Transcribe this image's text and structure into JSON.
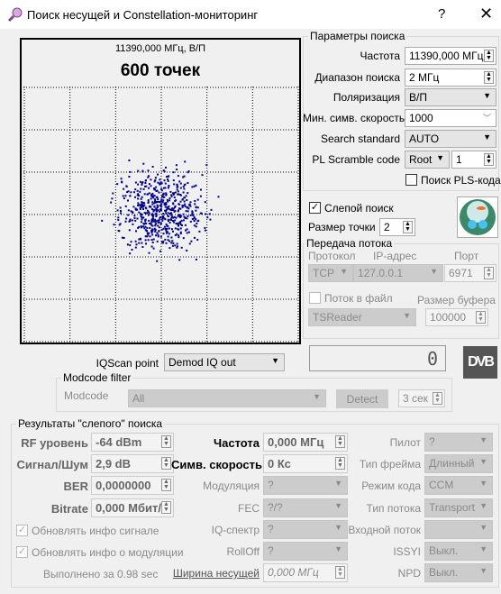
{
  "window": {
    "title": "Поиск несущей и Constellation-мониторинг",
    "help": "?",
    "close": "✕"
  },
  "plot": {
    "freq_label": "11390,000 МГц, В/П",
    "points_label": "600 точек",
    "point_color": "#00008b",
    "grid": "dotted 6x6"
  },
  "chart_data": {
    "type": "scatter",
    "point_count": 600,
    "center": [
      0,
      0
    ]
  },
  "search": {
    "title": "Параметры поиска",
    "freq_label": "Частота",
    "freq": "11390,000 МГц",
    "range_label": "Диапазон поиска",
    "range": "2 МГц",
    "pol_label": "Поляризация",
    "pol": "В/П",
    "minsr_label": "Мин. симв. скорость",
    "minsr": "1000",
    "std_label": "Search standard",
    "std": "AUTO",
    "pls_label": "PL Scramble code",
    "pls_mode": "Root",
    "pls_value": "1",
    "pls_search_label": "Поиск PLS-кода"
  },
  "blind": {
    "label": "Слепой поиск",
    "checked": true,
    "dot_size_label": "Размер точки",
    "dot_size": "2"
  },
  "stream": {
    "title": "Передача потока",
    "proto_label": "Протокол",
    "ip_label": "IP-адрес",
    "port_label": "Порт",
    "proto": "TCP",
    "ip": "127.0.0.1",
    "port": "6971",
    "tofile_label": "Поток в файл",
    "buffer_label": "Размер буфера",
    "reader": "TSReader",
    "buffer": "100000"
  },
  "counter": "0",
  "dvb_logo": "DVB",
  "iqscan": {
    "label": "IQScan point",
    "value": "Demod IQ out"
  },
  "modcode": {
    "title": "Modcode filter",
    "label": "Modcode",
    "value": "All",
    "detect": "Detect",
    "timeout": "3 сек"
  },
  "results": {
    "title": "Результаты \"слепого\" поиска",
    "rf_label": "RF уровень",
    "rf": "-64 dBm",
    "snr_label": "Сигнал/Шум",
    "snr": "2,9 dB",
    "ber_label": "BER",
    "ber": "0,0000000",
    "bitrate_label": "Bitrate",
    "bitrate": "0,000 Мбит/",
    "upd_signal": "Обновлять инфо сигнале",
    "upd_mod": "Обновлять инфо о модуляции",
    "done": "Выполнено за 0.98 sec",
    "freq_label": "Частота",
    "freq": "0,000 МГц",
    "sr_label": "Симв. скорость",
    "sr": "0 Кс",
    "mod_label": "Модуляция",
    "mod": "?",
    "fec_label": "FEC",
    "fec": "?/?",
    "iq_label": "IQ-спектр",
    "iq": "?",
    "rolloff_label": "RollOff",
    "rolloff": "?",
    "bw_label": "Ширина несущей",
    "bw": "0,000 МГц",
    "pilot_label": "Пилот",
    "pilot": "?",
    "frame_label": "Тип фрейма",
    "frame": "Длинный",
    "code_label": "Режим кода",
    "code": "CCM",
    "stype_label": "Тип потока",
    "stype": "Transport",
    "istream_label": "Входной поток",
    "istream": "",
    "issyi_label": "ISSYI",
    "issyi": "Выкл.",
    "npd_label": "NPD",
    "npd": "Выкл."
  }
}
